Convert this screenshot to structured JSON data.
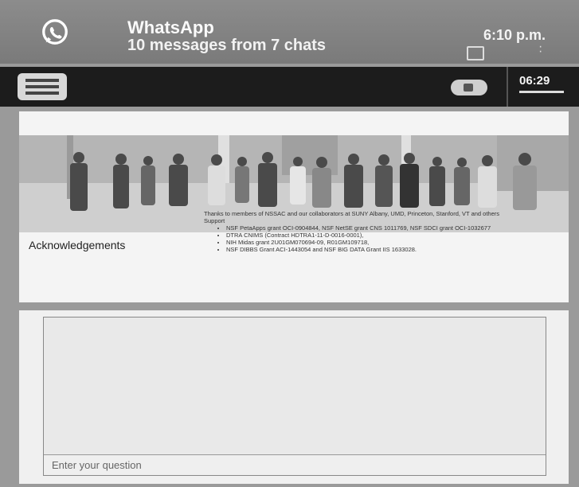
{
  "notification": {
    "app": "WhatsApp",
    "summary": "10 messages from 7 chats",
    "time": "6:10 p.m."
  },
  "toolbar": {
    "clock": "06:29"
  },
  "slide": {
    "heading": "Acknowledgements",
    "thanks": "Thanks to members of NSSAC and our collaborators at SUNY Albany, UMD, Princeton, Stanford, VT and others",
    "support_label": "Support",
    "support_items": [
      "NSF PetaApps grant OCI-0904844, NSF NetSE grant CNS 1011769, NSF SDCI grant OCI-1032677",
      "DTRA CNIMS (Contract HDTRA1-11-D-0016-0001),",
      "NIH Midas grant 2U01GM070694-09, R01GM109718,",
      "NSF DIBBS Grant ACI-1443054 and NSF BIG DATA Grant IIS 1633028."
    ]
  },
  "question": {
    "placeholder": "Enter your question"
  },
  "icons": {
    "whatsapp": "whatsapp-icon",
    "menu": "hamburger-menu-icon",
    "camera": "video-camera-icon"
  }
}
